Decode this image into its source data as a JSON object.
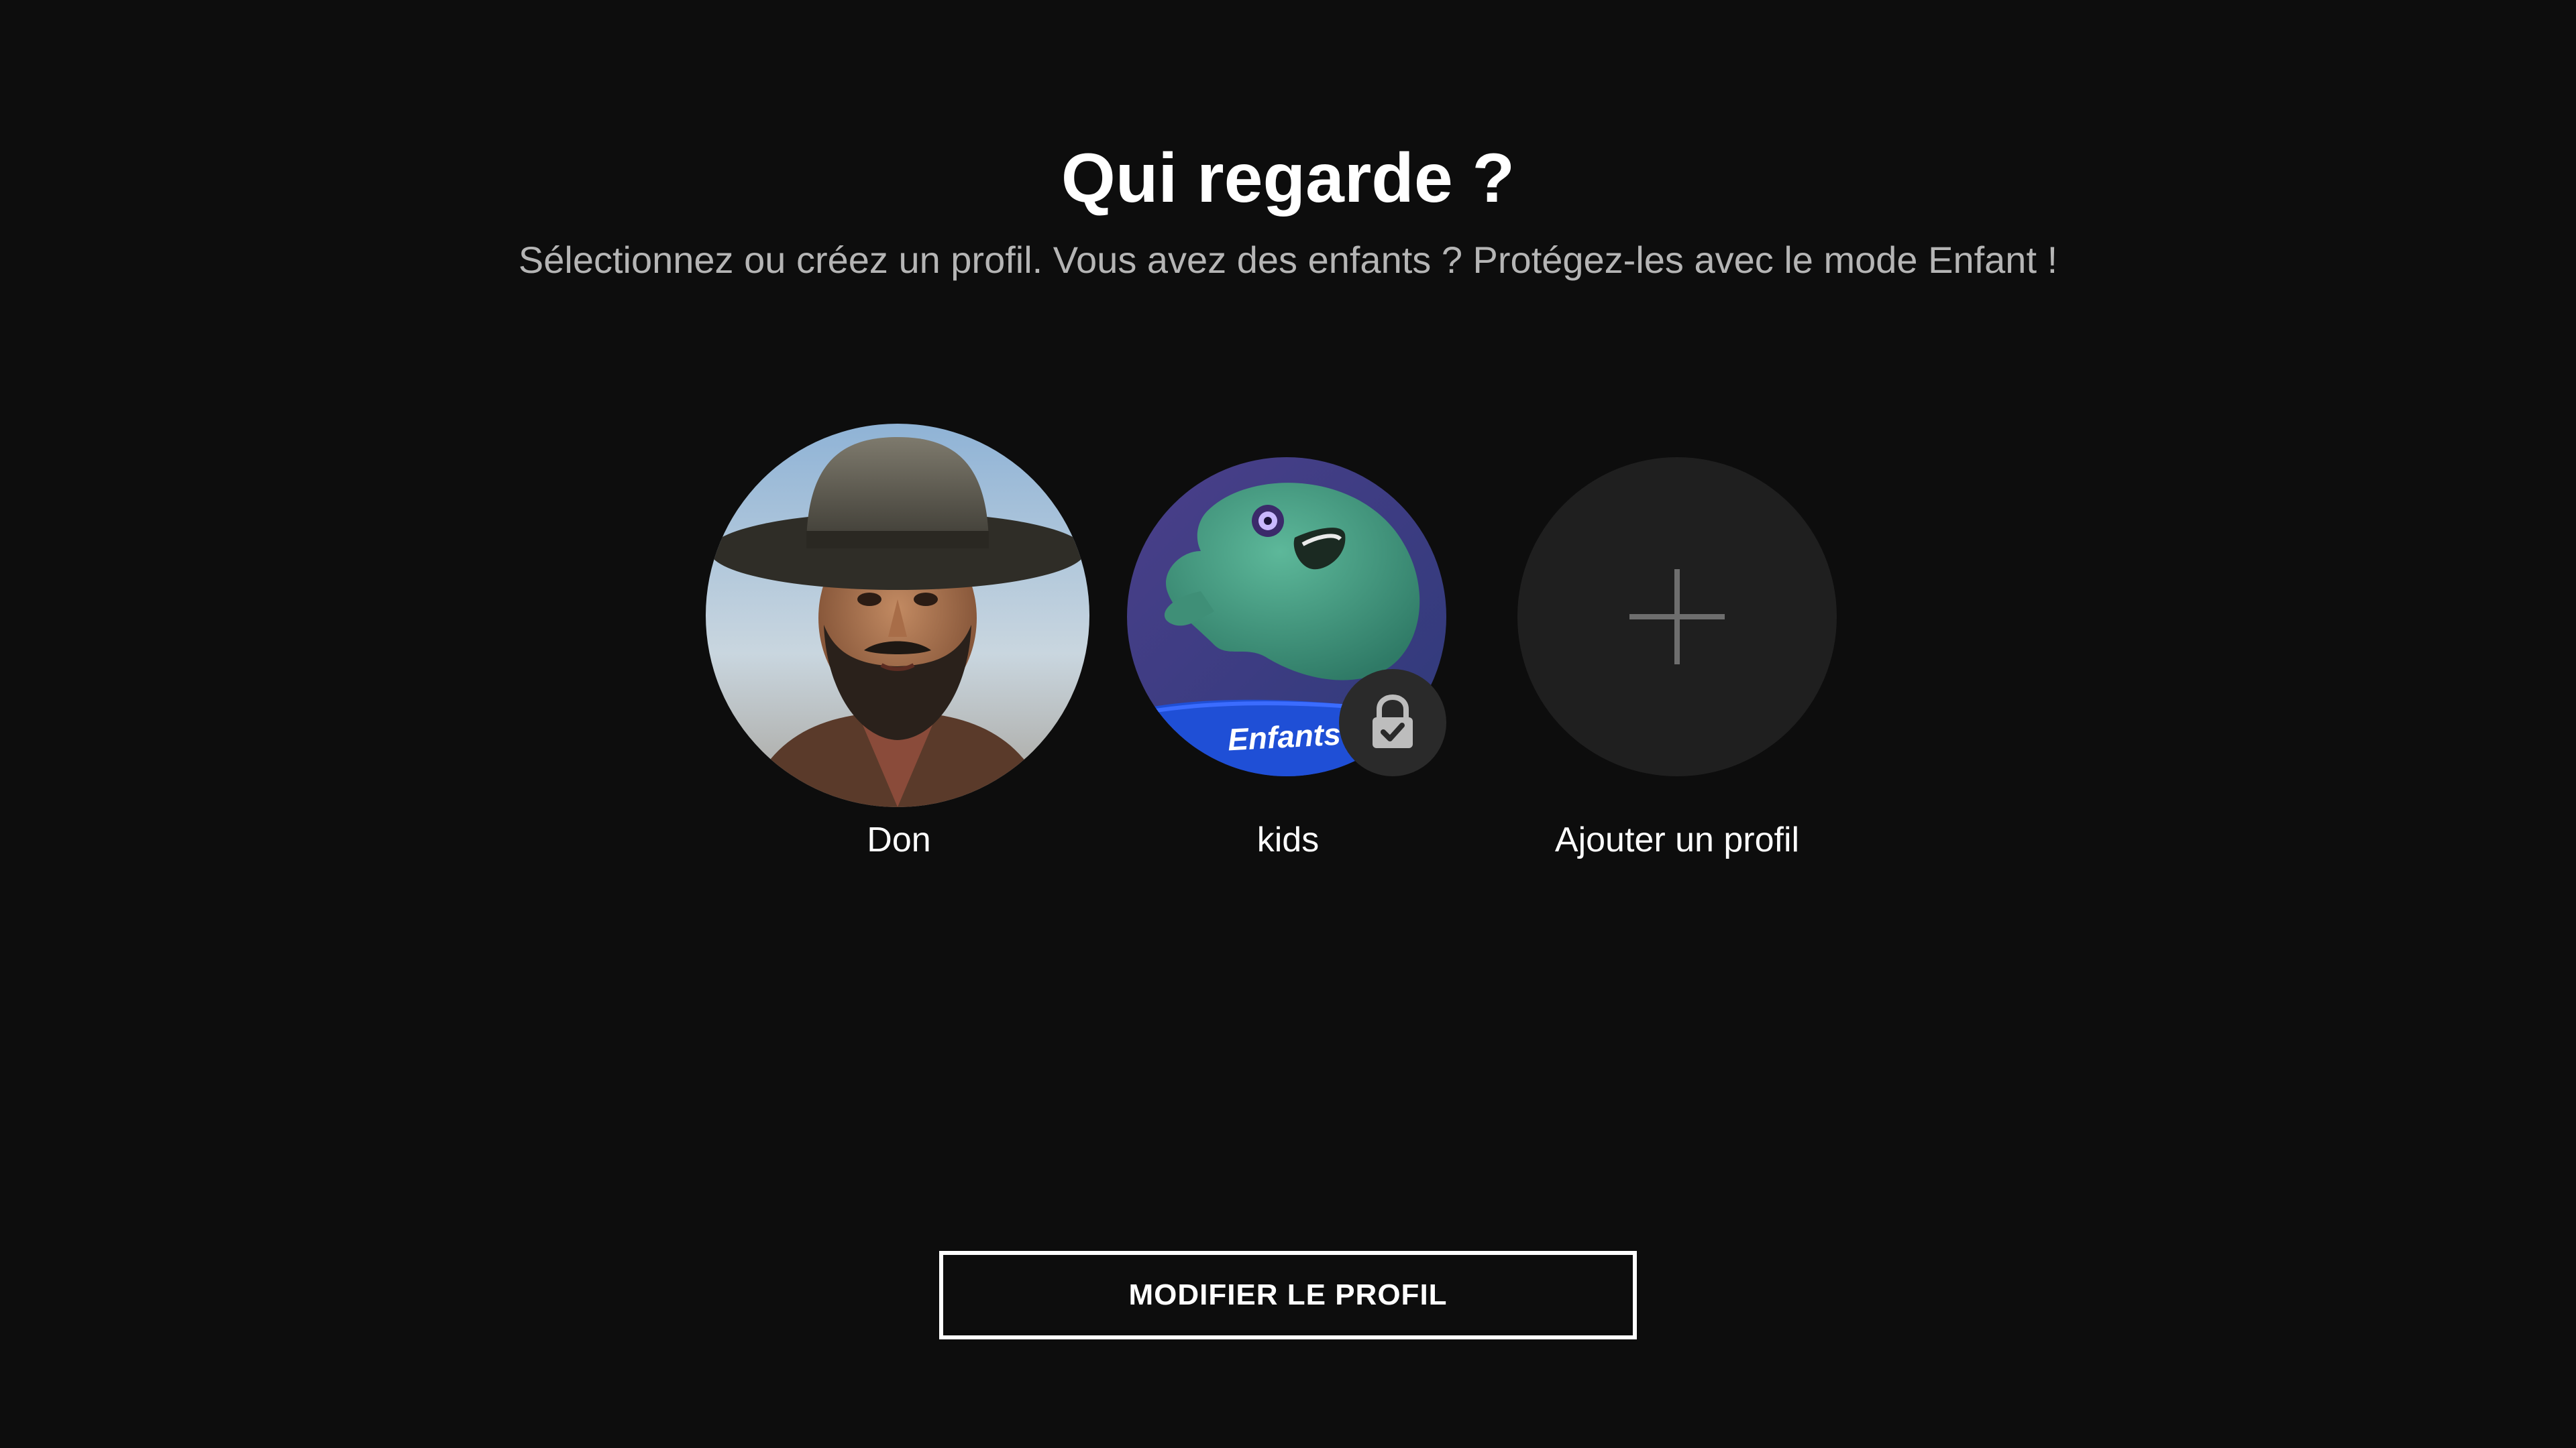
{
  "header": {
    "title": "Qui regarde ?",
    "subtitle": "Sélectionnez ou créez un profil. Vous avez des enfants ? Protégez-les avec le mode Enfant !"
  },
  "profiles": [
    {
      "name": "Don",
      "avatar": "cowboy-portrait",
      "locked": false
    },
    {
      "name": "kids",
      "avatar": "green-ghost-character",
      "badge_text": "Enfants",
      "locked": true,
      "badge_icon": "lock-check-icon"
    },
    {
      "name": "Ajouter un profil",
      "avatar": "plus-icon"
    }
  ],
  "footer": {
    "edit_label": "MODIFIER LE PROFIL"
  },
  "colors": {
    "background": "#0d0d0d",
    "text_primary": "#ffffff",
    "text_secondary": "#b5b5b5",
    "add_circle": "#1f1f1f",
    "kids_banner": "#1f4fd6"
  }
}
